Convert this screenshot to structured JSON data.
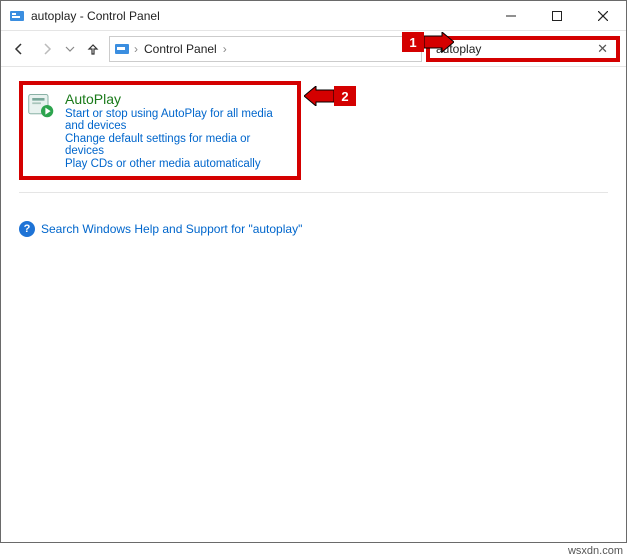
{
  "titlebar": {
    "title": "autoplay - Control Panel"
  },
  "navbar": {
    "breadcrumb_root": "Control Panel",
    "search_value": "autoplay"
  },
  "result": {
    "title": "AutoPlay",
    "link1": "Start or stop using AutoPlay for all media and devices",
    "link2": "Change default settings for media or devices",
    "link3": "Play CDs or other media automatically"
  },
  "help": {
    "text": "Search Windows Help and Support for \"autoplay\""
  },
  "annotations": {
    "step1": "1",
    "step2": "2"
  },
  "watermark": "wsxdn.com"
}
